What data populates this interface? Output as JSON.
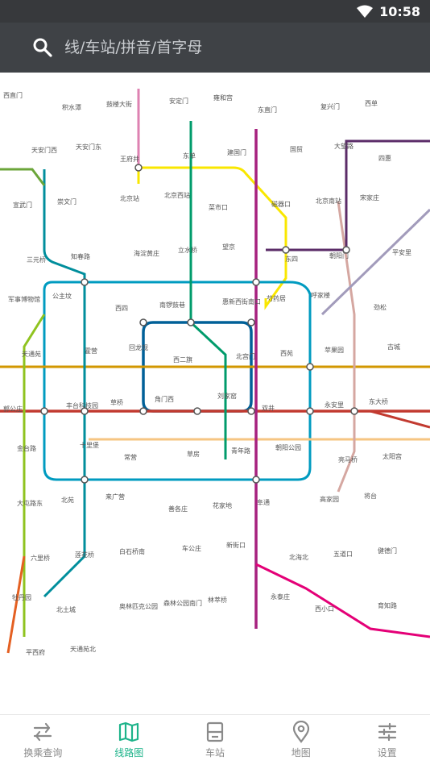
{
  "status": {
    "time": "10:58"
  },
  "search": {
    "placeholder": "线/车站/拼音/首字母"
  },
  "map": {
    "station_labels": [
      "西直门",
      "积水潭",
      "鼓楼大街",
      "安定门",
      "雍和宫",
      "东直门",
      "复兴门",
      "西单",
      "天安门西",
      "天安门东",
      "王府井",
      "东单",
      "建国门",
      "国贸",
      "大望路",
      "四惠",
      "宣武门",
      "崇文门",
      "北京站",
      "北京西站",
      "菜市口",
      "磁器口",
      "北京南站",
      "宋家庄",
      "三元桥",
      "知春路",
      "海淀黄庄",
      "立水桥",
      "望京",
      "东四",
      "朝阳门",
      "平安里",
      "军事博物馆",
      "公主坟",
      "西四",
      "南锣鼓巷",
      "惠新西街南口",
      "芍药居",
      "呼家楼",
      "劲松",
      "天通苑",
      "霍营",
      "回龙观",
      "西二旗",
      "北宫门",
      "西苑",
      "苹果园",
      "古城",
      "郭公庄",
      "丰台科技园",
      "草桥",
      "角门西",
      "刘家窑",
      "双井",
      "永安里",
      "东大桥",
      "金台路",
      "十里堡",
      "常营",
      "草房",
      "青年路",
      "朝阳公园",
      "亮马桥",
      "太阳宫",
      "大屯路东",
      "北苑",
      "来广营",
      "善各庄",
      "花家地",
      "阜通",
      "高家园",
      "将台",
      "六里桥",
      "莲花桥",
      "白石桥南",
      "车公庄",
      "新街口",
      "北海北",
      "五道口",
      "健德门",
      "牡丹园",
      "北土城",
      "奥林匹克公园",
      "森林公园南门",
      "林萃桥",
      "永泰庄",
      "西小口",
      "育知路",
      "平西府",
      "天通苑北"
    ]
  },
  "nav": {
    "items": [
      {
        "label": "换乘查询",
        "icon": "transfer-icon"
      },
      {
        "label": "线路图",
        "icon": "map-icon"
      },
      {
        "label": "车站",
        "icon": "station-icon"
      },
      {
        "label": "地图",
        "icon": "location-pin-icon"
      },
      {
        "label": "设置",
        "icon": "settings-sliders-icon"
      }
    ],
    "active_index": 1
  },
  "colors": {
    "status_bg": "#37393c",
    "search_bg": "#3f4246",
    "nav_active": "#1db38a",
    "nav_inactive": "#8a8a8a",
    "line1": "#c23a30",
    "line2": "#006098",
    "line4": "#008e9c",
    "line5": "#a6217f",
    "line6": "#d29700",
    "line7": "#f6c582",
    "line8": "#009b6b",
    "line9": "#8fc31f",
    "line10": "#009bc0",
    "line13": "#f9e700",
    "line14": "#d5a7a1",
    "line15": "#5b2c68",
    "line16": "#6ba539",
    "batong": "#c23a30",
    "changping": "#de82b2",
    "fangshan": "#e46022",
    "yizhuang": "#e40077",
    "airport": "#a29bbb",
    "xijiao": "#b8b8b8"
  }
}
